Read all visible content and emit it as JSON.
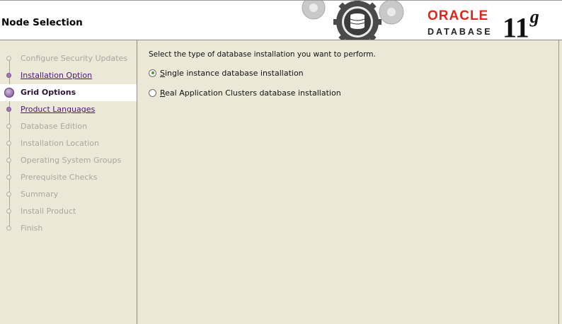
{
  "header": {
    "title": "Node Selection",
    "logo": {
      "brand": "ORACLE",
      "product": "DATABASE",
      "version": "11",
      "version_suffix": "g"
    },
    "brand_color": "#e0261c"
  },
  "sidebar": {
    "steps": [
      {
        "label": "Configure Security Updates",
        "state": "pending"
      },
      {
        "label": "Installation Option",
        "state": "done"
      },
      {
        "label": "Grid Options",
        "state": "current"
      },
      {
        "label": "Product Languages",
        "state": "done"
      },
      {
        "label": "Database Edition",
        "state": "pending"
      },
      {
        "label": "Installation Location",
        "state": "pending"
      },
      {
        "label": "Operating System Groups",
        "state": "pending"
      },
      {
        "label": "Prerequisite Checks",
        "state": "pending"
      },
      {
        "label": "Summary",
        "state": "pending"
      },
      {
        "label": "Install Product",
        "state": "pending"
      },
      {
        "label": "Finish",
        "state": "pending"
      }
    ]
  },
  "main": {
    "prompt": "Select the type of database installation you want to perform.",
    "options": [
      {
        "mnemonic": "S",
        "rest": "ingle instance database installation",
        "selected": true
      },
      {
        "mnemonic": "R",
        "rest": "eal Application Clusters database installation",
        "selected": false
      }
    ]
  }
}
